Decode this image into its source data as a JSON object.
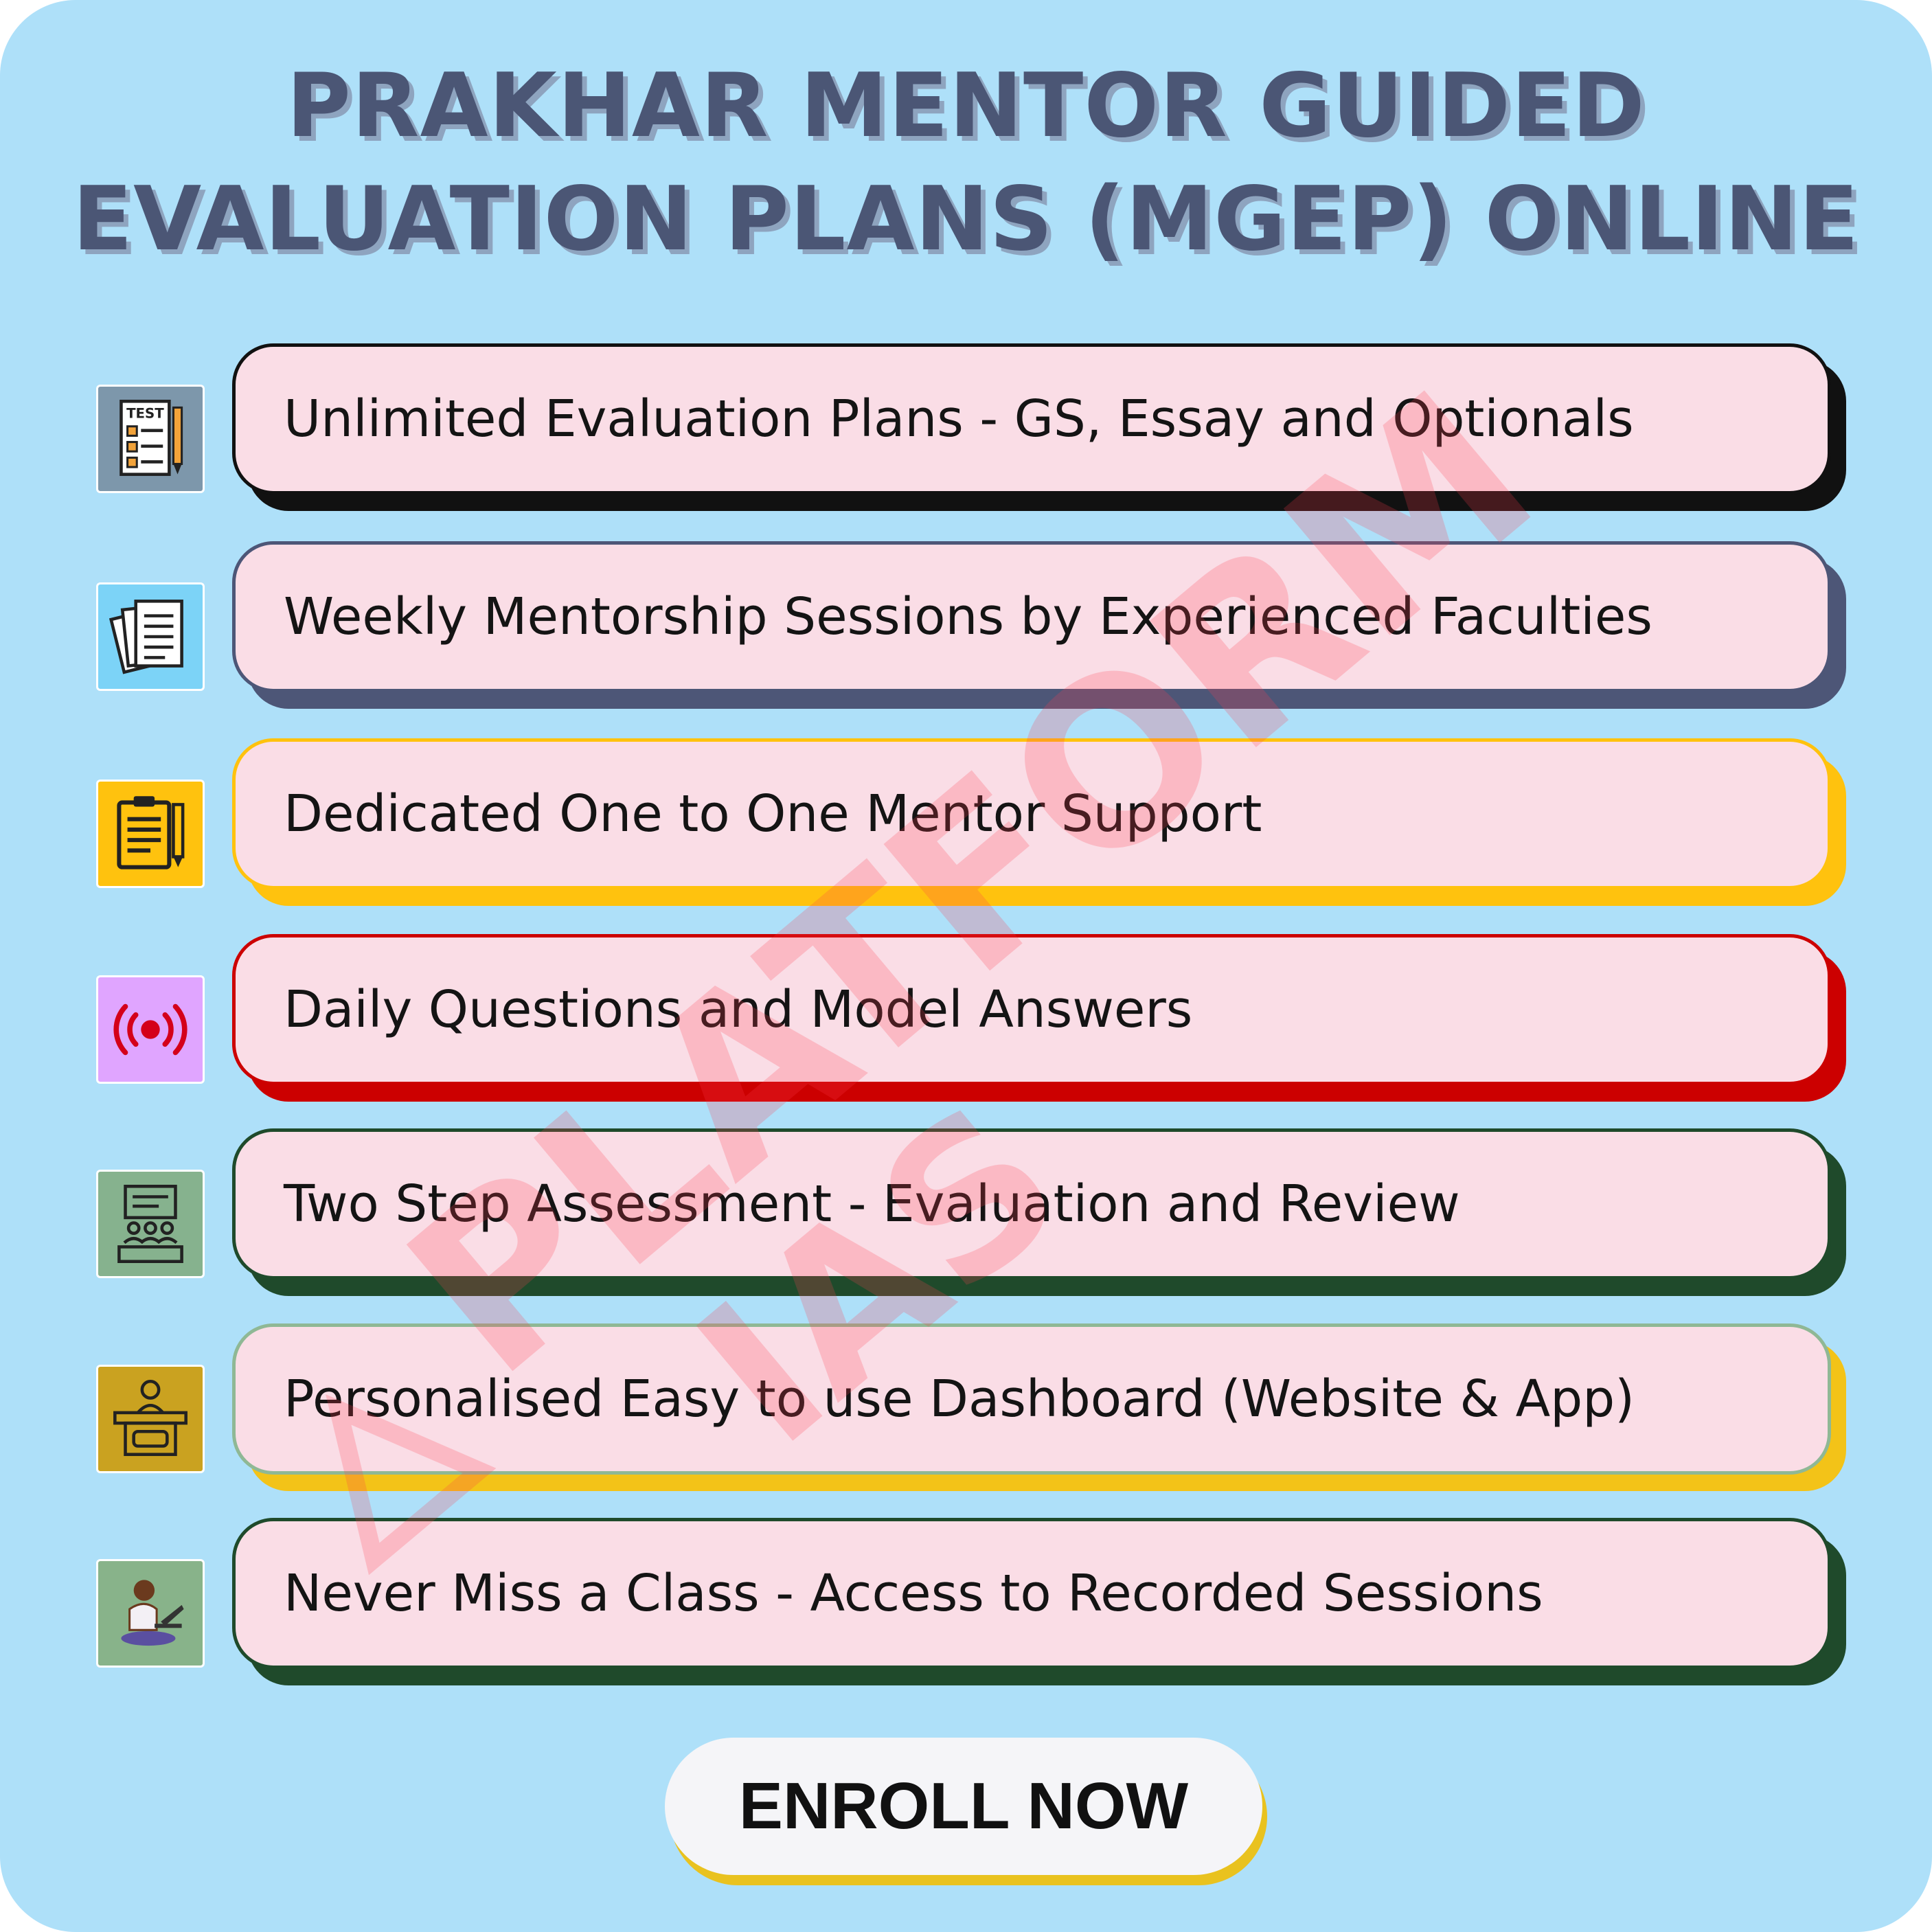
{
  "title": {
    "line1": "PRAKHAR MENTOR GUIDED",
    "line2": "EVALUATION PLANS (MGEP) ONLINE"
  },
  "features": [
    {
      "text": "Unlimited Evaluation Plans - GS, Essay and Optionals",
      "icon": "test-paper-icon",
      "icon_bg": "#7d97ab",
      "accent": "#111111"
    },
    {
      "text": "Weekly Mentorship Sessions by Experienced Faculties",
      "icon": "documents-icon",
      "icon_bg": "#7cd3f7",
      "accent": "#4d5677"
    },
    {
      "text": "Dedicated One to One Mentor Support",
      "icon": "clipboard-pencil-icon",
      "icon_bg": "#ffc20e",
      "accent": "#ffc20e"
    },
    {
      "text": "Daily Questions and Model Answers",
      "icon": "live-broadcast-icon",
      "icon_bg": "#e0a5ff",
      "accent": "#cc0000"
    },
    {
      "text": "Two Step Assessment - Evaluation and Review",
      "icon": "classroom-icon",
      "icon_bg": "#86b28e",
      "accent": "#1f4a2b"
    },
    {
      "text": "Personalised Easy to use Dashboard (Website & App)",
      "icon": "presenter-podium-icon",
      "icon_bg": "#caa220",
      "accent": "#f3c318"
    },
    {
      "text": "Never Miss a Class - Access to Recorded Sessions",
      "icon": "student-laptop-icon",
      "icon_bg": "#88b38a",
      "accent": "#1f4a2b"
    }
  ],
  "watermark": {
    "line1": "PLATFORM",
    "line2": "IAS"
  },
  "enroll_button": "ENROLL NOW"
}
